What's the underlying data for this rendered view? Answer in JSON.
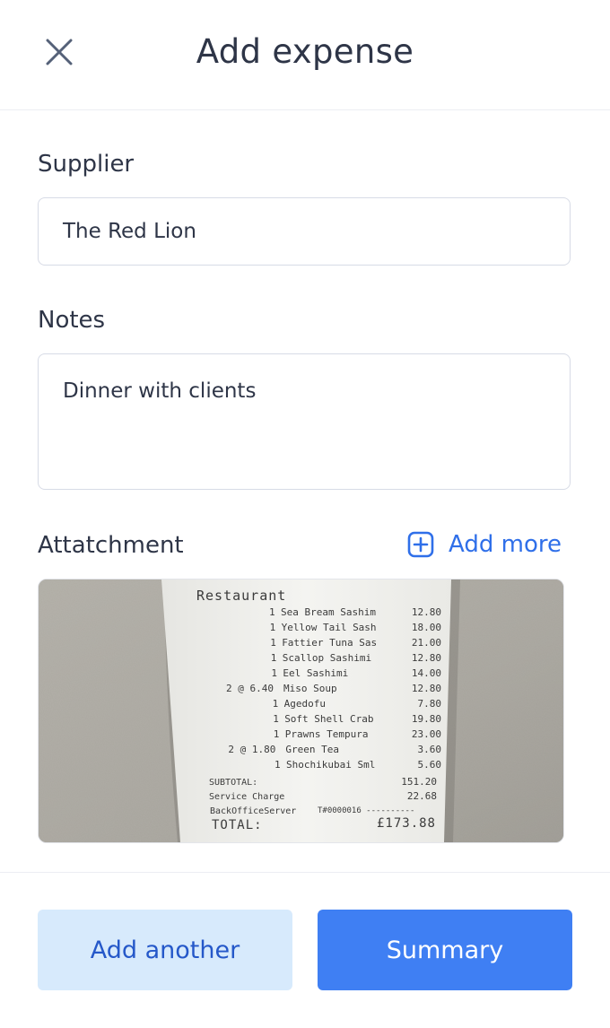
{
  "header": {
    "title": "Add expense",
    "close_icon": "close-icon"
  },
  "form": {
    "supplier": {
      "label": "Supplier",
      "value": "The Red Lion"
    },
    "notes": {
      "label": "Notes",
      "value": "Dinner with clients"
    },
    "attachment": {
      "label": "Attatchment",
      "add_more_label": "Add more",
      "add_more_icon": "plus-square-icon"
    }
  },
  "receipt": {
    "heading": "Restaurant",
    "items": [
      {
        "qty": "1",
        "name": "Sea Bream Sashim",
        "price": "12.80"
      },
      {
        "qty": "1",
        "name": "Yellow Tail Sash",
        "price": "18.00"
      },
      {
        "qty": "1",
        "name": "Fattier Tuna Sas",
        "price": "21.00"
      },
      {
        "qty": "1",
        "name": "Scallop Sashimi",
        "price": "12.80"
      },
      {
        "qty": "1",
        "name": "Eel Sashimi",
        "price": "14.00"
      },
      {
        "qty": "2 @   6.40",
        "name": "Miso Soup",
        "price": "12.80"
      },
      {
        "qty": "1",
        "name": "Agedofu",
        "price": "7.80"
      },
      {
        "qty": "1",
        "name": "Soft Shell Crab",
        "price": "19.80"
      },
      {
        "qty": "1",
        "name": "Prawns Tempura",
        "price": "23.00"
      },
      {
        "qty": "2 @   1.80",
        "name": "Green Tea",
        "price": "3.60"
      },
      {
        "qty": "1",
        "name": "Shochikubai Sml",
        "price": "5.60"
      }
    ],
    "subtotal_label": "SUBTOTAL:",
    "subtotal": "151.20",
    "service_label": "Service Charge",
    "service": "22.68",
    "server_label": "BackOfficeServer",
    "server_id": "T#0000016 ----------",
    "total_label": "TOTAL:",
    "total": "£173.88"
  },
  "actions": {
    "secondary_label": "Add another",
    "primary_label": "Summary"
  },
  "colors": {
    "accent": "#3f7ff3",
    "secondary_bg": "#d7eafc",
    "text": "#2e3547",
    "border": "#d7dbe6"
  }
}
